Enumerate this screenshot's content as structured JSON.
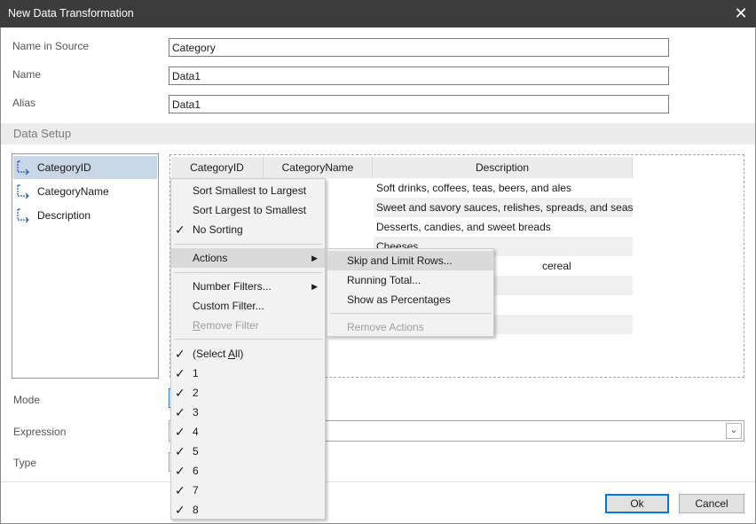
{
  "window": {
    "title": "New Data Transformation",
    "close_glyph": "✕"
  },
  "form": {
    "name_in_source": {
      "label": "Name in Source",
      "value": "Category"
    },
    "name": {
      "label": "Name",
      "value": "Data1"
    },
    "alias": {
      "label": "Alias",
      "value": "Data1"
    }
  },
  "data_setup": {
    "title": "Data Setup"
  },
  "fields": [
    {
      "label": "CategoryID",
      "icon": "field-icon"
    },
    {
      "label": "CategoryName",
      "icon": "field-icon"
    },
    {
      "label": "Description",
      "icon": "field-icon"
    }
  ],
  "grid": {
    "columns": [
      "CategoryID",
      "CategoryName",
      "Description"
    ],
    "rows": [
      "Soft drinks, coffees, teas, beers, and ales",
      "Sweet and savory sauces, relishes, spreads, and seasonings",
      "Desserts, candies, and sweet breads",
      "Cheeses",
      "cereal"
    ]
  },
  "lower": {
    "mode_label": "Mode",
    "expression_label": "Expression",
    "type_label": "Type",
    "dropdown_glyph": "⌄"
  },
  "buttons": {
    "ok": "Ok",
    "cancel": "Cancel"
  },
  "context_menu": {
    "sort_smallest": "Sort Smallest to Largest",
    "sort_largest": "Sort Largest to Smallest",
    "no_sorting": "No Sorting",
    "actions": "Actions",
    "number_filters": "Number Filters...",
    "custom_filter": "Custom Filter...",
    "remove_filter_first": "R",
    "remove_filter_rest": "emove Filter",
    "select_all_pre": "(Select ",
    "select_all_ul": "A",
    "select_all_post": "ll)",
    "values": [
      "1",
      "2",
      "3",
      "4",
      "5",
      "6",
      "7",
      "8"
    ],
    "check_glyph": "✓",
    "submenu_arrow": "▶"
  },
  "actions_menu": {
    "skip_limit": "Skip and Limit Rows...",
    "running_total": "Running Total...",
    "show_percentages": "Show as Percentages",
    "remove_actions": "Remove Actions"
  }
}
